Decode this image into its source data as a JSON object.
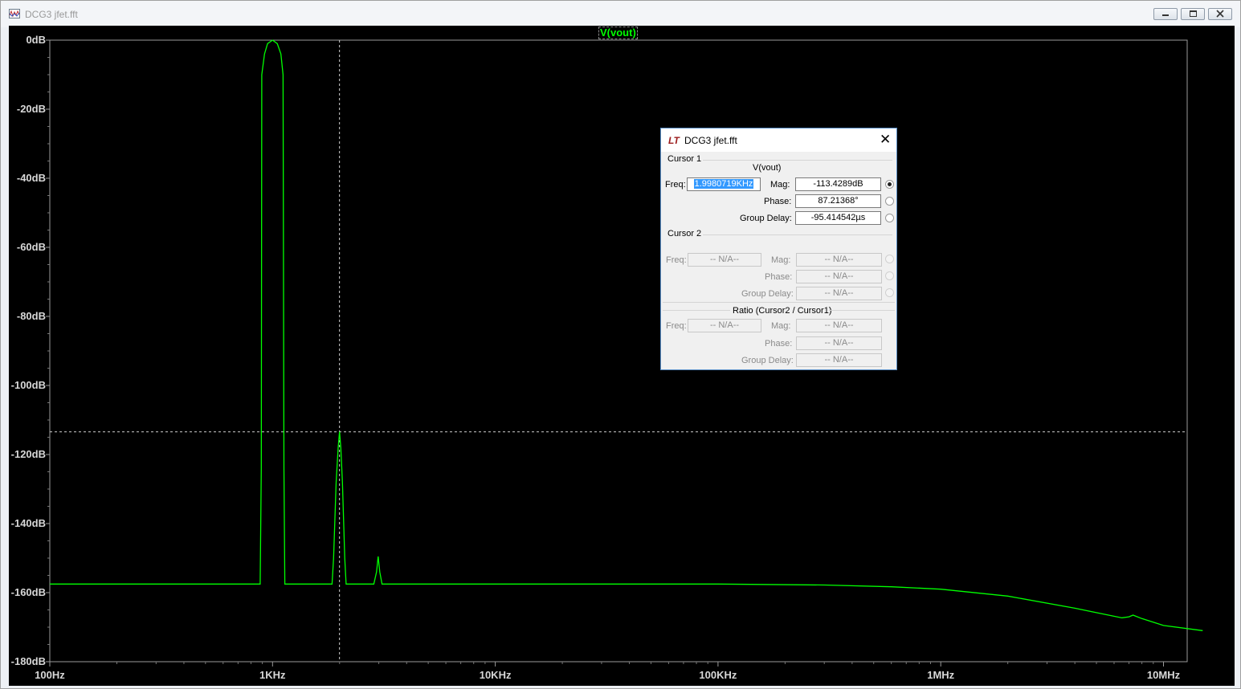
{
  "window": {
    "title": "DCG3 jfet.fft",
    "app_icon": "waveform-icon",
    "controls": [
      "minimize-icon",
      "maximize-icon",
      "close-icon"
    ]
  },
  "plot": {
    "trace_label": "V(vout)",
    "background_color": "#000000",
    "trace_color": "#00ff00",
    "y_ticks": [
      "0dB",
      "-20dB",
      "-40dB",
      "-60dB",
      "-80dB",
      "-100dB",
      "-120dB",
      "-140dB",
      "-160dB",
      "-180dB"
    ],
    "x_ticks": [
      "100Hz",
      "1KHz",
      "10KHz",
      "100KHz",
      "1MHz",
      "10MHz"
    ]
  },
  "chart_data": {
    "type": "line",
    "x_scale": "log",
    "xlim_hz": [
      100,
      15000000
    ],
    "ylim_db": [
      -180,
      0
    ],
    "series": [
      {
        "name": "V(vout)",
        "points_hz_db": [
          [
            100,
            -157.5
          ],
          [
            880,
            -157.5
          ],
          [
            890,
            -124
          ],
          [
            895,
            -10
          ],
          [
            920,
            -4
          ],
          [
            950,
            -1
          ],
          [
            1000,
            0
          ],
          [
            1050,
            -1
          ],
          [
            1090,
            -4
          ],
          [
            1115,
            -10
          ],
          [
            1125,
            -124
          ],
          [
            1135,
            -157.5
          ],
          [
            1850,
            -157.5
          ],
          [
            1880,
            -150
          ],
          [
            1930,
            -128
          ],
          [
            1970,
            -118
          ],
          [
            1998,
            -113.4
          ],
          [
            2025,
            -118
          ],
          [
            2060,
            -128
          ],
          [
            2110,
            -150
          ],
          [
            2140,
            -157.5
          ],
          [
            2850,
            -157.5
          ],
          [
            2930,
            -154
          ],
          [
            2980,
            -149.5
          ],
          [
            3030,
            -154
          ],
          [
            3100,
            -157.5
          ],
          [
            100000,
            -157.5
          ],
          [
            300000,
            -157.8
          ],
          [
            600000,
            -158.3
          ],
          [
            1000000,
            -159
          ],
          [
            2000000,
            -161
          ],
          [
            4000000,
            -164.5
          ],
          [
            6500000,
            -167.3
          ],
          [
            7000000,
            -167
          ],
          [
            7300000,
            -166.5
          ],
          [
            8000000,
            -167.5
          ],
          [
            10000000,
            -169.5
          ],
          [
            15000000,
            -171
          ]
        ]
      }
    ],
    "cursor": {
      "freq_hz": 1998.0719,
      "mag_db": -113.4289
    }
  },
  "cursor_dialog": {
    "logo": "LT",
    "title": "DCG3 jfet.fft",
    "close_icon": "close-icon",
    "cursor1": {
      "heading": "Cursor 1",
      "trace": "V(vout)",
      "freq_label": "Freq:",
      "freq_value": "1.9980719KHz",
      "mag_label": "Mag:",
      "mag_value": "-113.4289dB",
      "phase_label": "Phase:",
      "phase_value": "87.21368°",
      "group_delay_label": "Group Delay:",
      "group_delay_value": "-95.414542µs",
      "selected": "mag"
    },
    "cursor2": {
      "heading": "Cursor 2",
      "freq_label": "Freq:",
      "freq_value": "-- N/A--",
      "mag_label": "Mag:",
      "mag_value": "-- N/A--",
      "phase_label": "Phase:",
      "phase_value": "-- N/A--",
      "group_delay_label": "Group Delay:",
      "group_delay_value": "-- N/A--"
    },
    "ratio": {
      "heading": "Ratio (Cursor2 / Cursor1)",
      "freq_label": "Freq:",
      "freq_value": "-- N/A--",
      "mag_label": "Mag:",
      "mag_value": "-- N/A--",
      "phase_label": "Phase:",
      "phase_value": "-- N/A--",
      "group_delay_label": "Group Delay:",
      "group_delay_value": "-- N/A--"
    }
  }
}
